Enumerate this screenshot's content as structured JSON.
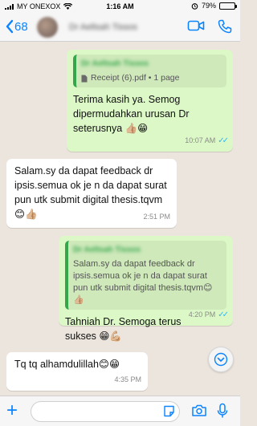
{
  "status_bar": {
    "carrier": "MY ONEXOX",
    "time": "1:16 AM",
    "battery": "79%",
    "battery_level": 0.79
  },
  "header": {
    "back_count": "68",
    "contact_name": "Dr Aeltsah Tissos"
  },
  "messages": [
    {
      "direction": "outgoing",
      "quote_author": "Dr Aeltsah Tissos",
      "attachment": "Receipt (6).pdf • 1 page",
      "text": "Terima kasih ya. Semog dipermudahkan urusan Dr seterusnya 👍🏼😁",
      "time": "10:07 AM"
    },
    {
      "direction": "incoming",
      "text": "Salam.sy da dapat feedback dr ipsis.semua ok je n da dapat surat pun utk submit digital thesis.tqvm😊👍🏼",
      "time": "2:51 PM"
    },
    {
      "direction": "outgoing",
      "quote_author": "Dr Aeltsah Tissos",
      "quote_text": "Salam.sy da dapat feedback dr ipsis.semua ok je n da dapat surat pun utk submit digital thesis.tqvm😊👍🏼",
      "text": "Tahniah Dr. Semoga terus sukses 😁💪🏼",
      "time": "4:20 PM"
    },
    {
      "direction": "incoming",
      "text": "Tq tq alhamdulillah😊😁",
      "time": "4:35 PM"
    }
  ],
  "input": {
    "placeholder": "",
    "value": ""
  },
  "colors": {
    "accent": "#0a84ff",
    "outgoing_bubble": "#dcf8c6",
    "incoming_bubble": "#ffffff",
    "chat_background": "#ece5dd",
    "read_ticks": "#34b7f1",
    "quote_bar": "#35a64c"
  },
  "icons": {
    "back": "chevron-left-icon",
    "video_call": "video-camera-icon",
    "voice_call": "phone-icon",
    "scroll_down": "chevron-down-icon",
    "attach": "plus-icon",
    "sticker": "sticker-icon",
    "camera": "camera-icon",
    "mic": "microphone-icon"
  }
}
